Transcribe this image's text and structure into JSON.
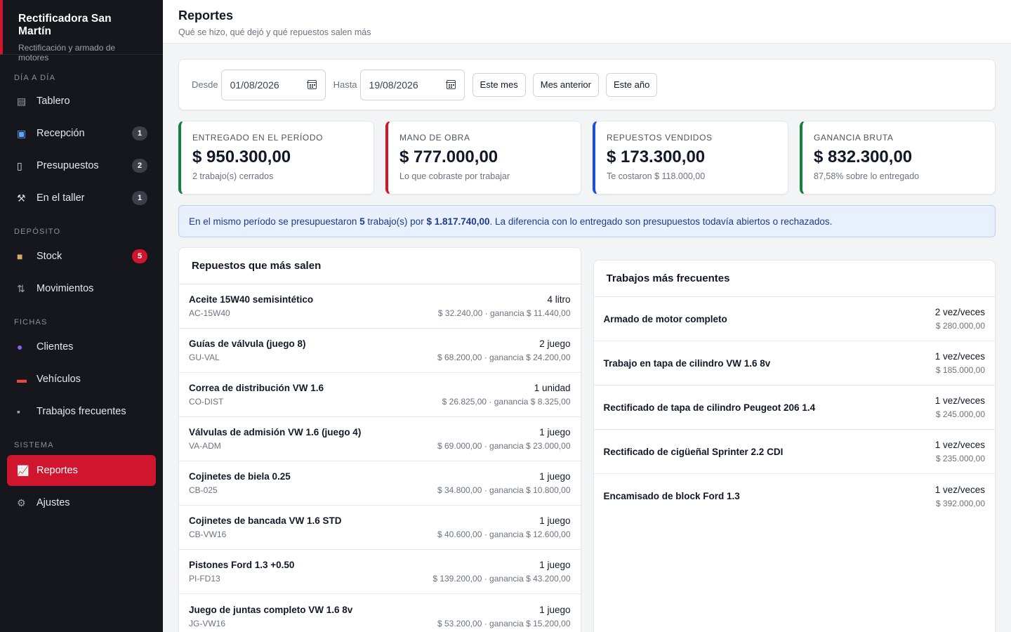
{
  "brand": {
    "title": "Rectificadora San Martín",
    "subtitle": "Rectificación y armado de motores"
  },
  "nav": {
    "sections": {
      "dia": "DÍA A DÍA",
      "deposito": "DEPÓSITO",
      "fichas": "FICHAS",
      "sistema": "SISTEMA"
    },
    "items": {
      "tablero": {
        "label": "Tablero",
        "icon": "clipboard-icon"
      },
      "recepcion": {
        "label": "Recepción",
        "badge": "1",
        "icon": "inbox-icon"
      },
      "presupuestos": {
        "label": "Presupuestos",
        "badge": "2",
        "icon": "document-icon"
      },
      "taller": {
        "label": "En el taller",
        "badge": "1",
        "icon": "wrench-icon"
      },
      "stock": {
        "label": "Stock",
        "badge": "5",
        "icon": "package-icon"
      },
      "movimientos": {
        "label": "Movimientos",
        "icon": "arrows-icon"
      },
      "clientes": {
        "label": "Clientes",
        "icon": "user-icon"
      },
      "vehiculos": {
        "label": "Vehículos",
        "icon": "car-icon"
      },
      "trabajos": {
        "label": "Trabajos frecuentes",
        "icon": "tools-icon"
      },
      "reportes": {
        "label": "Reportes",
        "icon": "chart-icon"
      },
      "ajustes": {
        "label": "Ajustes",
        "icon": "gear-icon"
      }
    }
  },
  "header": {
    "title": "Reportes",
    "subtitle": "Qué se hizo, qué dejó y qué repuestos salen más"
  },
  "filters": {
    "desde_label": "Desde",
    "desde_value": "01/08/2026",
    "hasta_label": "Hasta",
    "hasta_value": "19/08/2026",
    "btn_este_mes": "Este mes",
    "btn_mes_anterior": "Mes anterior",
    "btn_este_anio": "Este año"
  },
  "kpis": [
    {
      "label": "Entregado en el período",
      "value": "$ 950.300,00",
      "note": "2 trabajo(s) cerrados",
      "color": "#15803d"
    },
    {
      "label": "Mano de obra",
      "value": "$ 777.000,00",
      "note": "Lo que cobraste por trabajar",
      "color": "#d0162f"
    },
    {
      "label": "Repuestos vendidos",
      "value": "$ 173.300,00",
      "note": "Te costaron $ 118.000,00",
      "color": "#1d4ed8"
    },
    {
      "label": "Ganancia bruta",
      "value": "$ 832.300,00",
      "note": "87,58% sobre lo entregado",
      "color": "#15803d"
    }
  ],
  "info": {
    "pre": "En el mismo período se presupuestaron ",
    "count": "5",
    "mid": " trabajo(s) por ",
    "amount": "$ 1.817.740,00",
    "post": ". La diferencia con lo entregado son presupuestos todavía abiertos o rechazados."
  },
  "repuestos": {
    "title": "Repuestos que más salen",
    "rows": [
      {
        "name": "Aceite 15W40 semisintético",
        "code": "AC-15W40",
        "qty": "4 litro",
        "money": "$ 32.240,00 · ganancia $ 11.440,00"
      },
      {
        "name": "Guías de válvula (juego 8)",
        "code": "GU-VAL",
        "qty": "2 juego",
        "money": "$ 68.200,00 · ganancia $ 24.200,00"
      },
      {
        "name": "Correa de distribución VW 1.6",
        "code": "CO-DIST",
        "qty": "1 unidad",
        "money": "$ 26.825,00 · ganancia $ 8.325,00"
      },
      {
        "name": "Válvulas de admisión VW 1.6 (juego 4)",
        "code": "VA-ADM",
        "qty": "1 juego",
        "money": "$ 69.000,00 · ganancia $ 23.000,00"
      },
      {
        "name": "Cojinetes de biela 0.25",
        "code": "CB-025",
        "qty": "1 juego",
        "money": "$ 34.800,00 · ganancia $ 10.800,00"
      },
      {
        "name": "Cojinetes de bancada VW 1.6 STD",
        "code": "CB-VW16",
        "qty": "1 juego",
        "money": "$ 40.600,00 · ganancia $ 12.600,00"
      },
      {
        "name": "Pistones Ford 1.3 +0.50",
        "code": "PI-FD13",
        "qty": "1 juego",
        "money": "$ 139.200,00 · ganancia $ 43.200,00"
      },
      {
        "name": "Juego de juntas completo VW 1.6 8v",
        "code": "JG-VW16",
        "qty": "1 juego",
        "money": "$ 53.200,00 · ganancia $ 15.200,00"
      }
    ]
  },
  "trabajos": {
    "title": "Trabajos más frecuentes",
    "rows": [
      {
        "name": "Armado de motor completo",
        "qty": "2 vez/veces",
        "money": "$ 280.000,00"
      },
      {
        "name": "Trabajo en tapa de cilindro VW 1.6 8v",
        "qty": "1 vez/veces",
        "money": "$ 185.000,00"
      },
      {
        "name": "Rectificado de tapa de cilindro Peugeot 206 1.4",
        "qty": "1 vez/veces",
        "money": "$ 245.000,00"
      },
      {
        "name": "Rectificado de cigüeñal Sprinter 2.2 CDI",
        "qty": "1 vez/veces",
        "money": "$ 235.000,00"
      },
      {
        "name": "Encamisado de block Ford 1.3",
        "qty": "1 vez/veces",
        "money": "$ 392.000,00"
      }
    ]
  }
}
